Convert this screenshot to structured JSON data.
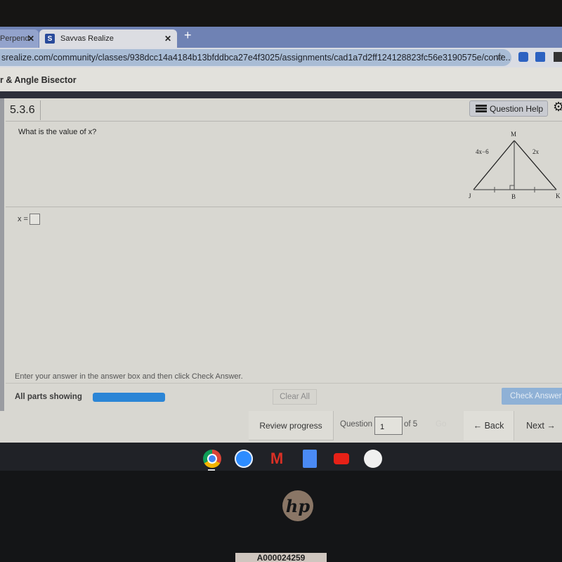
{
  "browser": {
    "tabs": [
      {
        "title": "Perpend",
        "active": false
      },
      {
        "title": "Savvas Realize",
        "active": true,
        "favicon": "S"
      }
    ],
    "new_tab_label": "+",
    "close_glyph": "✕",
    "url": "srealize.com/community/classes/938dcc14a4184b13bfddbca27e4f3025/assignments/cad1a7d2ff124128823fc56e3190575e/conte...",
    "bookmark_icon": "☆"
  },
  "header": {
    "assignment_title": "r & Angle Bisector"
  },
  "question": {
    "number": "5.3.6",
    "help_label": "Question Help",
    "gear_icon": "⚙",
    "prompt": "What is the value of x?",
    "figure": {
      "vertices": {
        "top": "M",
        "left": "J",
        "right": "K",
        "foot": "B"
      },
      "side_labels": {
        "left": "4x−6",
        "right": "2x"
      }
    },
    "answer_label": "x =",
    "answer_value": ""
  },
  "footer": {
    "instruction": "Enter your answer in the answer box and then click Check Answer.",
    "parts_label": "All parts showing",
    "progress_fraction": 1.0,
    "clear_label": "Clear All",
    "check_label": "Check Answer"
  },
  "nav": {
    "review_label": "Review progress",
    "question_label": "Question",
    "question_value": "1",
    "of_label": "of 5",
    "go_label": "Go",
    "back_label": "← Back",
    "next_label": "Next →"
  },
  "shelf": {
    "apps": [
      "Chrome",
      "Meet",
      "Gmail",
      "Docs",
      "YouTube",
      "Play Store"
    ]
  },
  "bezel": {
    "logo": "hp",
    "asset_tag": "A000024259"
  }
}
